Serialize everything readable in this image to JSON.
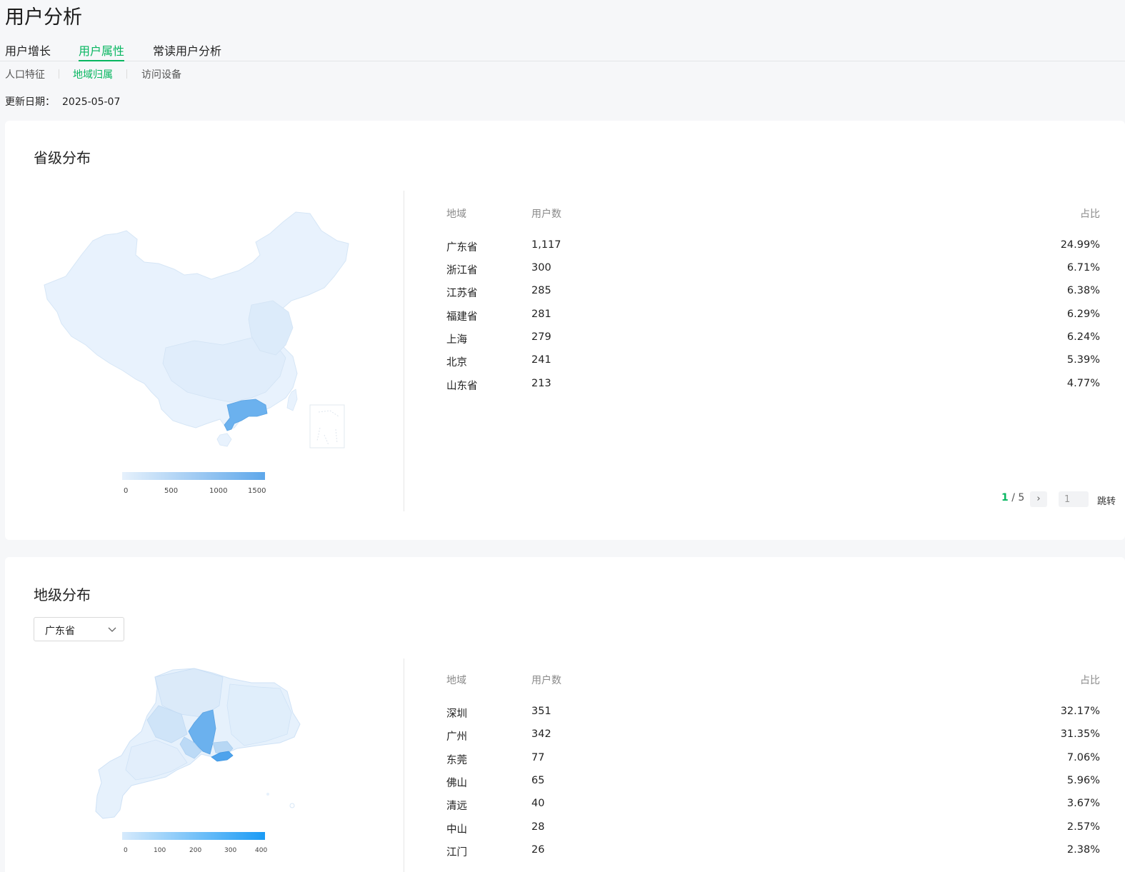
{
  "page": {
    "title": "用户分析"
  },
  "tabs": [
    {
      "label": "用户增长"
    },
    {
      "label": "用户属性"
    },
    {
      "label": "常读用户分析"
    }
  ],
  "subtabs": [
    {
      "label": "人口特征"
    },
    {
      "label": "地域归属"
    },
    {
      "label": "访问设备"
    }
  ],
  "update": {
    "label": "更新日期：",
    "date": "2025-05-07"
  },
  "province_section": {
    "title": "省级分布",
    "columns": {
      "region": "地域",
      "users": "用户数",
      "share": "占比"
    },
    "rows": [
      {
        "region": "广东省",
        "users": "1,117",
        "share": "24.99%"
      },
      {
        "region": "浙江省",
        "users": "300",
        "share": "6.71%"
      },
      {
        "region": "江苏省",
        "users": "285",
        "share": "6.38%"
      },
      {
        "region": "福建省",
        "users": "281",
        "share": "6.29%"
      },
      {
        "region": "上海",
        "users": "279",
        "share": "6.24%"
      },
      {
        "region": "北京",
        "users": "241",
        "share": "5.39%"
      },
      {
        "region": "山东省",
        "users": "213",
        "share": "4.77%"
      }
    ],
    "legend": {
      "ticks": [
        "0",
        "500",
        "1000",
        "1500"
      ]
    },
    "pager": {
      "current": "1",
      "total": "5",
      "input": "1",
      "jump": "跳转",
      "next_icon": "›"
    }
  },
  "city_section": {
    "title": "地级分布",
    "select_value": "广东省",
    "columns": {
      "region": "地域",
      "users": "用户数",
      "share": "占比"
    },
    "rows": [
      {
        "region": "深圳",
        "users": "351",
        "share": "32.17%"
      },
      {
        "region": "广州",
        "users": "342",
        "share": "31.35%"
      },
      {
        "region": "东莞",
        "users": "77",
        "share": "7.06%"
      },
      {
        "region": "佛山",
        "users": "65",
        "share": "5.96%"
      },
      {
        "region": "清远",
        "users": "40",
        "share": "3.67%"
      },
      {
        "region": "中山",
        "users": "28",
        "share": "2.57%"
      },
      {
        "region": "江门",
        "users": "26",
        "share": "2.38%"
      }
    ],
    "legend": {
      "ticks": [
        "0",
        "100",
        "200",
        "300",
        "400"
      ]
    }
  },
  "colors": {
    "accent": "#07b660",
    "map_base": "#e8f2fd",
    "map_high": "#6bb1ee",
    "map_max": "#1a9bf5"
  }
}
